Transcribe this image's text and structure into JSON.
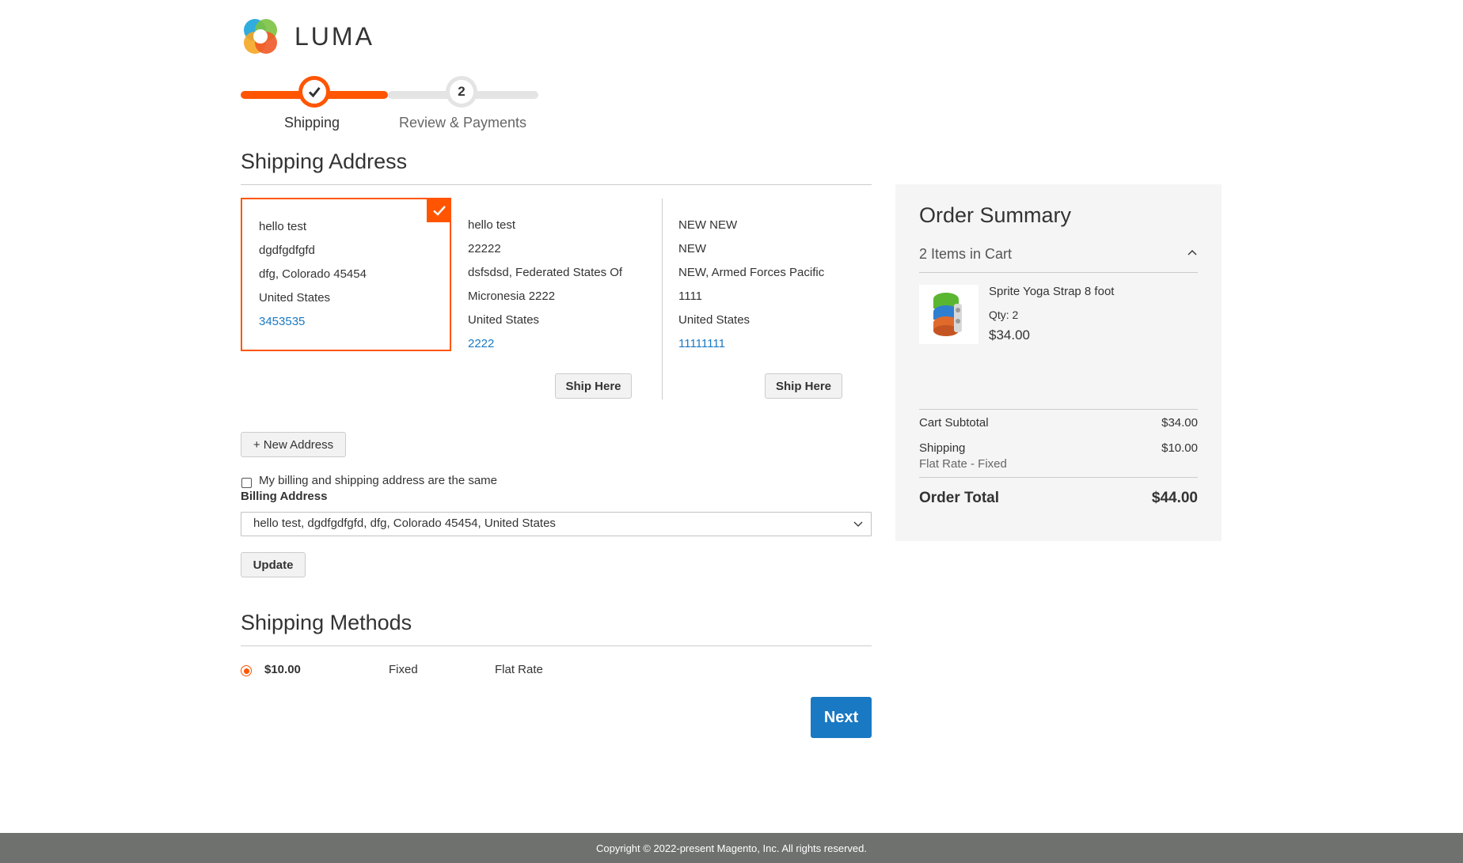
{
  "brand": {
    "name": "LUMA"
  },
  "progress": {
    "steps": [
      {
        "label": "Shipping",
        "state": "complete"
      },
      {
        "label": "Review & Payments",
        "number": "2",
        "state": "pending"
      }
    ]
  },
  "shipping_address": {
    "title": "Shipping Address",
    "addresses": [
      {
        "lines": [
          "hello test",
          "dgdfgdfgfd",
          "dfg, Colorado 45454",
          "United States"
        ],
        "phone": "3453535",
        "selected": true
      },
      {
        "lines": [
          "hello test",
          "22222",
          "dsfsdsd, Federated States Of",
          "Micronesia 2222",
          "United States"
        ],
        "phone": "2222",
        "button": "Ship Here"
      },
      {
        "lines": [
          "NEW NEW",
          "NEW",
          "NEW, Armed Forces Pacific",
          "1111",
          "United States"
        ],
        "phone": "11111111",
        "button": "Ship Here"
      }
    ],
    "new_address_button": "+ New Address"
  },
  "billing": {
    "same_as_shipping_label": "My billing and shipping address are the same",
    "same_as_shipping_checked": false,
    "label": "Billing Address",
    "selected_option": "hello test, dgdfgdfgfd, dfg, Colorado 45454, United States",
    "update_button": "Update"
  },
  "shipping_methods": {
    "title": "Shipping Methods",
    "methods": [
      {
        "price": "$10.00",
        "method": "Fixed",
        "carrier": "Flat Rate",
        "selected": true
      }
    ]
  },
  "next_button": "Next",
  "order_summary": {
    "title": "Order Summary",
    "items_in_cart": "2 Items in Cart",
    "items": [
      {
        "name": "Sprite Yoga Strap 8 foot",
        "qty": "Qty: 2",
        "price": "$34.00"
      }
    ],
    "cart_subtotal_label": "Cart Subtotal",
    "cart_subtotal": "$34.00",
    "shipping_label": "Shipping",
    "shipping_method": "Flat Rate - Fixed",
    "shipping_amount": "$10.00",
    "order_total_label": "Order Total",
    "order_total": "$44.00"
  },
  "footer": {
    "copyright": "Copyright © 2022-present Magento, Inc. All rights reserved."
  },
  "colors": {
    "accent": "#ff5501",
    "link": "#1979c3",
    "primary_button": "#1979c3",
    "footer_bg": "#6e716e"
  }
}
